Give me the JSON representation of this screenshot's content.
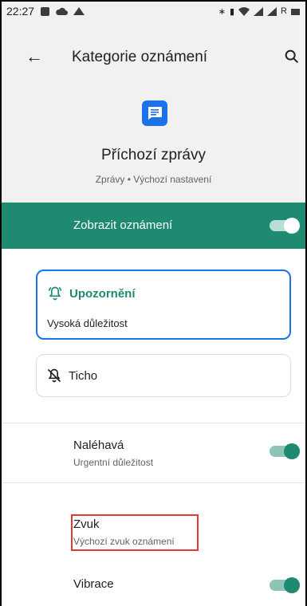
{
  "status_bar": {
    "time": "22:27",
    "right_text": "R"
  },
  "app_bar": {
    "title": "Kategorie oznámení"
  },
  "app_header": {
    "name": "Příchozí zprávy",
    "subtitle": "Zprávy • Výchozí nastavení",
    "icon_color": "#1a73e8"
  },
  "master_toggle": {
    "label": "Zobrazit oznámení",
    "on": true,
    "color": "#1e8a72"
  },
  "alert_card": {
    "title": "Upozornění",
    "description": "Vysoká důležitost",
    "selected": true
  },
  "silent_card": {
    "title": "Ticho",
    "selected": false
  },
  "urgent_row": {
    "label": "Naléhavá",
    "sublabel": "Urgentní důležitost",
    "on": true
  },
  "sound_row": {
    "label": "Zvuk",
    "sublabel": "Výchozí zvuk oznámení"
  },
  "vibration_row": {
    "label": "Vibrace",
    "on": true
  }
}
